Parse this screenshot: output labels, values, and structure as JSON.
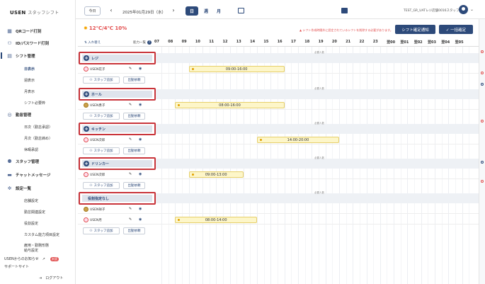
{
  "sidebar": {
    "logo": "USEN",
    "logo_sub": "スタッフシフト",
    "items": [
      {
        "label": "QRコード打刻"
      },
      {
        "label": "ID/パスワード打刻"
      },
      {
        "label": "シフト管理"
      },
      {
        "label": "勤怠管理"
      },
      {
        "label": "スタッフ管理"
      },
      {
        "label": "チャットメッセージ"
      },
      {
        "label": "設定一覧"
      }
    ],
    "shift_sub": [
      "日表示",
      "週表示",
      "月表示",
      "シフト必要枠"
    ],
    "attend_sub": [
      "日次（勤怠承認）",
      "月次（勤怠締め）",
      "休暇承認"
    ],
    "settings_sub": [
      "店舗設定",
      "勤怠関連設定",
      "役割設定",
      "カスタム能力項目設定",
      "雇用・勤務形態",
      "給与設定"
    ],
    "news": "USENからのお知らせ",
    "news_badge": "未読",
    "support": "サポートサイト",
    "logout": "ログアウト"
  },
  "topbar": {
    "today": "今日",
    "date": "2025年01月29日（水）",
    "view_day": "日",
    "view_week": "週",
    "view_month": "月",
    "store": "TEST_GR_UATレジ店舗0016スタッフ"
  },
  "toolbar": {
    "weather": "12℃/4℃ 10%",
    "warning": "シフト作成時間外に設定されているシフトを削除する必要があります。",
    "confirm_button": "シフト確定通知",
    "bulk_button": "✓ 一括確定"
  },
  "header": {
    "swap": "入れ替え",
    "ability": "能力一覧",
    "hours": [
      "07",
      "08",
      "09",
      "10",
      "11",
      "12",
      "13",
      "14",
      "15",
      "16",
      "17",
      "18",
      "19",
      "20",
      "21",
      "22",
      "23",
      "翌00",
      "翌01",
      "翌02",
      "翌03",
      "翌04",
      "翌05"
    ]
  },
  "groups": [
    {
      "name": "レジ",
      "required": "必要人数",
      "staff": [
        {
          "name": "USEN花子",
          "shift": "09:00-16:00"
        }
      ]
    },
    {
      "name": "ホール",
      "required": "必要人数",
      "staff": [
        {
          "name": "USEN勇子",
          "shift": "08:00-16:00"
        }
      ]
    },
    {
      "name": "キッチン",
      "required": "必要人数",
      "staff": [
        {
          "name": "USEN次郎",
          "shift": "14:00-20:00"
        }
      ]
    },
    {
      "name": "ドリンカー",
      "required": "必要人数",
      "staff": [
        {
          "name": "USEN次郎",
          "shift": "09:00-13:00"
        }
      ]
    },
    {
      "name": "役割指定なし",
      "required": "必要人数",
      "staff": [
        {
          "name": "USEN祥子",
          "shift": ""
        },
        {
          "name": "USEN月",
          "shift": "08:00-14:00"
        }
      ]
    }
  ],
  "actions": {
    "add_staff": "スタッフ追加",
    "required_staff": "出勤依頼"
  },
  "colors": {
    "primary": "#2d4a7a",
    "highlight": "#c9343a",
    "shift_fill": "#fdf6c9"
  }
}
